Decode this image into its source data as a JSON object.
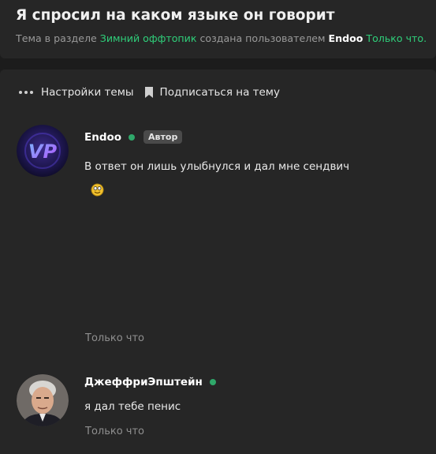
{
  "header": {
    "title": "Я спросил на каком языке он говорит",
    "sub_prefix": "Тема в разделе ",
    "section": "Зимний оффтопик",
    "sub_middle": " создана пользователем ",
    "author": "Endoo",
    "time": "Только что."
  },
  "toolbar": {
    "settings_label": "Настройки темы",
    "subscribe_label": "Подписаться на тему"
  },
  "posts": [
    {
      "username": "Endoo",
      "badge": "Автор",
      "message": "В ответ он лишь улыбнулся и дал мне сендвич",
      "time": "Только что",
      "avatar_text": "VP"
    },
    {
      "username": "ДжеффриЭпштейн",
      "message": "я дал тебе пенис",
      "time": "Только что"
    }
  ],
  "colors": {
    "accent_link": "#2fcf7a",
    "online": "#2fa86a",
    "background": "#1c1c1c",
    "panel": "#262626"
  },
  "icons": [
    "more-dots-icon",
    "bookmark-icon",
    "online-indicator",
    "smiley-emoji"
  ]
}
